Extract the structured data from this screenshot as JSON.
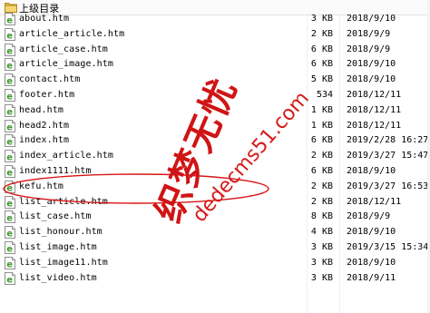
{
  "parent_row": {
    "label": "上级目录"
  },
  "files": [
    {
      "name": "about.htm",
      "size": "3 KB",
      "date": "2018/9/10"
    },
    {
      "name": "article_article.htm",
      "size": "2 KB",
      "date": "2018/9/9"
    },
    {
      "name": "article_case.htm",
      "size": "6 KB",
      "date": "2018/9/9"
    },
    {
      "name": "article_image.htm",
      "size": "6 KB",
      "date": "2018/9/10"
    },
    {
      "name": "contact.htm",
      "size": "5 KB",
      "date": "2018/9/10"
    },
    {
      "name": "footer.htm",
      "size": "534",
      "date": "2018/12/11"
    },
    {
      "name": "head.htm",
      "size": "1 KB",
      "date": "2018/12/11"
    },
    {
      "name": "head2.htm",
      "size": "1 KB",
      "date": "2018/12/11"
    },
    {
      "name": "index.htm",
      "size": "6 KB",
      "date": "2019/2/28 16:27"
    },
    {
      "name": "index_article.htm",
      "size": "2 KB",
      "date": "2019/3/27 15:47"
    },
    {
      "name": "index1111.htm",
      "size": "6 KB",
      "date": "2018/9/10"
    },
    {
      "name": "kefu.htm",
      "size": "2 KB",
      "date": "2019/3/27 16:53"
    },
    {
      "name": "list_article.htm",
      "size": "2 KB",
      "date": "2018/12/11"
    },
    {
      "name": "list_case.htm",
      "size": "8 KB",
      "date": "2018/9/9"
    },
    {
      "name": "list_honour.htm",
      "size": "4 KB",
      "date": "2018/9/10"
    },
    {
      "name": "list_image.htm",
      "size": "3 KB",
      "date": "2019/3/15 15:34"
    },
    {
      "name": "list_image11.htm",
      "size": "3 KB",
      "date": "2018/9/10"
    },
    {
      "name": "list_video.htm",
      "size": "3 KB",
      "date": "2018/9/11"
    }
  ],
  "icons": {
    "parent": "folder-up-icon",
    "file": "html-file-icon"
  },
  "colors": {
    "file_icon_green": "#3d9a2a",
    "annotation_red": "#d81515"
  },
  "watermark": {
    "cn_text": "织梦无忧",
    "url_text": "dedecms51.com"
  },
  "highlighted_file": "kefu.htm"
}
